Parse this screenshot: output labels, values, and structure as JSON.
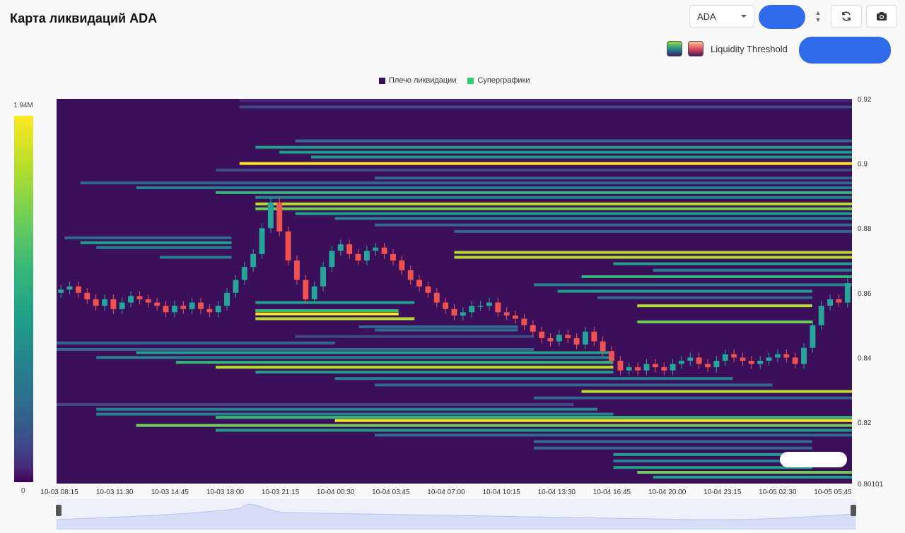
{
  "header": {
    "title": "Карта ликвидаций ADA",
    "symbol_select": "ADA",
    "refresh_icon": "refresh-icon",
    "camera_icon": "camera-icon"
  },
  "threshold": {
    "label": "Liquidity Threshold",
    "swatch_1": "viridis-swatch",
    "swatch_2": "magma-swatch"
  },
  "legend": {
    "items": [
      {
        "label": "Плечо ликвидации",
        "color": "#3b0f59"
      },
      {
        "label": "Суперграфики",
        "color": "#2ecc71"
      }
    ]
  },
  "colorbar": {
    "max_label": "1.94M",
    "min_label": "0"
  },
  "chart_data": {
    "type": "heatmap",
    "title": "Карта ликвидаций ADA",
    "colorscale": "viridis",
    "colorbar_range": [
      0,
      1940000
    ],
    "grid": false,
    "y_axis": {
      "ticks": [
        "0.92",
        "0.9",
        "0.88",
        "0.86",
        "0.84",
        "0.82",
        "0.80101"
      ],
      "range": [
        0.80101,
        0.92
      ]
    },
    "x_axis": {
      "ticks": [
        "10-03 08:15",
        "10-03 11:30",
        "10-03 14:45",
        "10-03 18:00",
        "10-03 21:15",
        "10-04 00:30",
        "10-04 03:45",
        "10-04 07:00",
        "10-04 10:15",
        "10-04 13:30",
        "10-04 16:45",
        "10-04 20:00",
        "10-04 23:15",
        "10-05 02:30",
        "10-05 05:45"
      ]
    },
    "price_series": {
      "name": "ADA",
      "up_color": "#26a69a",
      "down_color": "#ef5350",
      "close": [
        0.861,
        0.862,
        0.86,
        0.858,
        0.856,
        0.858,
        0.855,
        0.857,
        0.859,
        0.858,
        0.857,
        0.856,
        0.854,
        0.856,
        0.855,
        0.857,
        0.855,
        0.854,
        0.856,
        0.86,
        0.864,
        0.868,
        0.872,
        0.88,
        0.888,
        0.879,
        0.87,
        0.864,
        0.858,
        0.862,
        0.868,
        0.873,
        0.875,
        0.872,
        0.87,
        0.873,
        0.874,
        0.872,
        0.87,
        0.867,
        0.864,
        0.862,
        0.86,
        0.857,
        0.855,
        0.853,
        0.854,
        0.856,
        0.856,
        0.857,
        0.854,
        0.853,
        0.852,
        0.85,
        0.848,
        0.846,
        0.845,
        0.847,
        0.846,
        0.844,
        0.848,
        0.845,
        0.842,
        0.839,
        0.836,
        0.837,
        0.836,
        0.838,
        0.837,
        0.836,
        0.838,
        0.839,
        0.84,
        0.838,
        0.837,
        0.839,
        0.841,
        0.84,
        0.839,
        0.838,
        0.839,
        0.84,
        0.841,
        0.84,
        0.838,
        0.843,
        0.85,
        0.856,
        0.858,
        0.857,
        0.863
      ]
    },
    "liquidation_levels": [
      {
        "price": 0.9195,
        "start": 0.23,
        "end": 1.0,
        "intensity": 0.15
      },
      {
        "price": 0.9175,
        "start": 0.23,
        "end": 1.0,
        "intensity": 0.2
      },
      {
        "price": 0.907,
        "start": 0.3,
        "end": 1.0,
        "intensity": 0.35
      },
      {
        "price": 0.905,
        "start": 0.25,
        "end": 1.0,
        "intensity": 0.55
      },
      {
        "price": 0.9035,
        "start": 0.28,
        "end": 1.0,
        "intensity": 0.6
      },
      {
        "price": 0.902,
        "start": 0.32,
        "end": 1.0,
        "intensity": 0.5
      },
      {
        "price": 0.9,
        "start": 0.23,
        "end": 1.0,
        "intensity": 0.95
      },
      {
        "price": 0.898,
        "start": 0.2,
        "end": 1.0,
        "intensity": 0.25
      },
      {
        "price": 0.8955,
        "start": 0.4,
        "end": 1.0,
        "intensity": 0.3
      },
      {
        "price": 0.894,
        "start": 0.03,
        "end": 1.0,
        "intensity": 0.35
      },
      {
        "price": 0.8925,
        "start": 0.1,
        "end": 1.0,
        "intensity": 0.45
      },
      {
        "price": 0.891,
        "start": 0.2,
        "end": 1.0,
        "intensity": 0.7
      },
      {
        "price": 0.8895,
        "start": 0.25,
        "end": 1.0,
        "intensity": 0.4
      },
      {
        "price": 0.8875,
        "start": 0.25,
        "end": 1.0,
        "intensity": 0.9
      },
      {
        "price": 0.886,
        "start": 0.25,
        "end": 1.0,
        "intensity": 0.8
      },
      {
        "price": 0.8845,
        "start": 0.3,
        "end": 1.0,
        "intensity": 0.5
      },
      {
        "price": 0.883,
        "start": 0.35,
        "end": 1.0,
        "intensity": 0.4
      },
      {
        "price": 0.881,
        "start": 0.4,
        "end": 1.0,
        "intensity": 0.35
      },
      {
        "price": 0.879,
        "start": 0.5,
        "end": 1.0,
        "intensity": 0.3
      },
      {
        "price": 0.877,
        "start": 0.01,
        "end": 0.22,
        "intensity": 0.3
      },
      {
        "price": 0.8755,
        "start": 0.03,
        "end": 0.22,
        "intensity": 0.5
      },
      {
        "price": 0.874,
        "start": 0.05,
        "end": 0.22,
        "intensity": 0.45
      },
      {
        "price": 0.8725,
        "start": 0.5,
        "end": 1.0,
        "intensity": 0.85
      },
      {
        "price": 0.871,
        "start": 0.13,
        "end": 0.22,
        "intensity": 0.4
      },
      {
        "price": 0.871,
        "start": 0.5,
        "end": 1.0,
        "intensity": 0.9
      },
      {
        "price": 0.869,
        "start": 0.7,
        "end": 1.0,
        "intensity": 0.5
      },
      {
        "price": 0.867,
        "start": 0.75,
        "end": 1.0,
        "intensity": 0.4
      },
      {
        "price": 0.865,
        "start": 0.66,
        "end": 1.0,
        "intensity": 0.7
      },
      {
        "price": 0.8625,
        "start": 0.6,
        "end": 1.0,
        "intensity": 0.4
      },
      {
        "price": 0.8605,
        "start": 0.63,
        "end": 0.95,
        "intensity": 0.5
      },
      {
        "price": 0.8585,
        "start": 0.68,
        "end": 0.95,
        "intensity": 0.35
      },
      {
        "price": 0.857,
        "start": 0.25,
        "end": 0.45,
        "intensity": 0.5
      },
      {
        "price": 0.856,
        "start": 0.73,
        "end": 0.95,
        "intensity": 0.85
      },
      {
        "price": 0.8545,
        "start": 0.25,
        "end": 0.43,
        "intensity": 0.65
      },
      {
        "price": 0.8535,
        "start": 0.25,
        "end": 0.43,
        "intensity": 0.95
      },
      {
        "price": 0.852,
        "start": 0.25,
        "end": 0.45,
        "intensity": 0.85
      },
      {
        "price": 0.851,
        "start": 0.73,
        "end": 0.95,
        "intensity": 0.8
      },
      {
        "price": 0.8495,
        "start": 0.38,
        "end": 0.58,
        "intensity": 0.35
      },
      {
        "price": 0.8485,
        "start": 0.4,
        "end": 0.58,
        "intensity": 0.3
      },
      {
        "price": 0.8465,
        "start": 0.3,
        "end": 0.6,
        "intensity": 0.25
      },
      {
        "price": 0.8445,
        "start": 0.0,
        "end": 0.35,
        "intensity": 0.3
      },
      {
        "price": 0.8425,
        "start": 0.0,
        "end": 0.6,
        "intensity": 0.35
      },
      {
        "price": 0.8415,
        "start": 0.1,
        "end": 0.7,
        "intensity": 0.6
      },
      {
        "price": 0.84,
        "start": 0.05,
        "end": 0.7,
        "intensity": 0.45
      },
      {
        "price": 0.8385,
        "start": 0.15,
        "end": 0.7,
        "intensity": 0.7
      },
      {
        "price": 0.837,
        "start": 0.2,
        "end": 0.7,
        "intensity": 0.85
      },
      {
        "price": 0.8355,
        "start": 0.25,
        "end": 0.7,
        "intensity": 0.5
      },
      {
        "price": 0.8335,
        "start": 0.35,
        "end": 0.85,
        "intensity": 0.4
      },
      {
        "price": 0.8315,
        "start": 0.4,
        "end": 0.9,
        "intensity": 0.35
      },
      {
        "price": 0.8295,
        "start": 0.66,
        "end": 1.0,
        "intensity": 0.9
      },
      {
        "price": 0.8275,
        "start": 0.6,
        "end": 1.0,
        "intensity": 0.3
      },
      {
        "price": 0.8255,
        "start": 0.0,
        "end": 0.65,
        "intensity": 0.25
      },
      {
        "price": 0.824,
        "start": 0.05,
        "end": 0.68,
        "intensity": 0.4
      },
      {
        "price": 0.8225,
        "start": 0.05,
        "end": 0.7,
        "intensity": 0.45
      },
      {
        "price": 0.8215,
        "start": 0.2,
        "end": 1.0,
        "intensity": 0.7
      },
      {
        "price": 0.8205,
        "start": 0.35,
        "end": 1.0,
        "intensity": 0.95
      },
      {
        "price": 0.819,
        "start": 0.1,
        "end": 1.0,
        "intensity": 0.8
      },
      {
        "price": 0.8175,
        "start": 0.2,
        "end": 1.0,
        "intensity": 0.6
      },
      {
        "price": 0.816,
        "start": 0.4,
        "end": 1.0,
        "intensity": 0.35
      },
      {
        "price": 0.814,
        "start": 0.6,
        "end": 0.95,
        "intensity": 0.35
      },
      {
        "price": 0.812,
        "start": 0.6,
        "end": 0.95,
        "intensity": 0.3
      },
      {
        "price": 0.81,
        "start": 0.7,
        "end": 0.95,
        "intensity": 0.5
      },
      {
        "price": 0.808,
        "start": 0.7,
        "end": 0.95,
        "intensity": 0.45
      },
      {
        "price": 0.806,
        "start": 0.7,
        "end": 0.95,
        "intensity": 0.6
      },
      {
        "price": 0.8045,
        "start": 0.73,
        "end": 1.0,
        "intensity": 0.8
      },
      {
        "price": 0.803,
        "start": 0.75,
        "end": 1.0,
        "intensity": 0.55
      }
    ]
  }
}
